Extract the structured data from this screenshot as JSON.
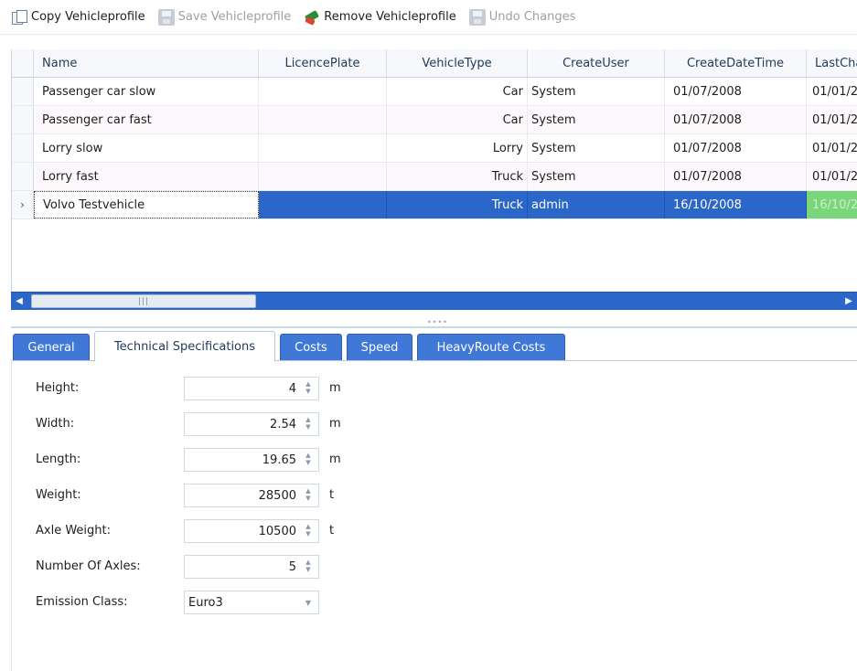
{
  "toolbar": {
    "copy_label": "Copy Vehicleprofile",
    "save_label": "Save Vehicleprofile",
    "remove_label": "Remove Vehicleprofile",
    "undo_label": "Undo Changes"
  },
  "grid": {
    "columns": [
      "Name",
      "LicencePlate",
      "VehicleType",
      "CreateUser",
      "CreateDateTime",
      "LastCha"
    ],
    "rows": [
      {
        "name": "Passenger car slow",
        "licence": "",
        "type": "Car",
        "user": "System",
        "created": "01/07/2008",
        "last": "01/01/2"
      },
      {
        "name": "Passenger car fast",
        "licence": "",
        "type": "Car",
        "user": "System",
        "created": "01/07/2008",
        "last": "01/01/2"
      },
      {
        "name": "Lorry slow",
        "licence": "",
        "type": "Lorry",
        "user": "System",
        "created": "01/07/2008",
        "last": "01/01/2"
      },
      {
        "name": "Lorry fast",
        "licence": "",
        "type": "Truck",
        "user": "System",
        "created": "01/07/2008",
        "last": "01/01/2"
      },
      {
        "name": "Volvo Testvehicle",
        "licence": "",
        "type": "Truck",
        "user": "admin",
        "created": "16/10/2008",
        "last": "16/10/2"
      }
    ],
    "selected_row_marker": "›",
    "scroll_left_arrow": "◀",
    "scroll_right_arrow": "▶",
    "scroll_grip": "|||"
  },
  "tabs": [
    "General",
    "Technical Specifications",
    "Costs",
    "Speed",
    "HeavyRoute Costs"
  ],
  "active_tab": "Technical Specifications",
  "specs": {
    "height": {
      "label": "Height:",
      "value": "4",
      "unit": "m"
    },
    "width": {
      "label": "Width:",
      "value": "2.54",
      "unit": "m"
    },
    "length": {
      "label": "Length:",
      "value": "19.65",
      "unit": "m"
    },
    "weight": {
      "label": "Weight:",
      "value": "28500",
      "unit": "t"
    },
    "axle_weight": {
      "label": "Axle Weight:",
      "value": "10500",
      "unit": "t"
    },
    "axles": {
      "label": "Number Of Axles:",
      "value": "5"
    },
    "emission": {
      "label": "Emission Class:",
      "value": "Euro3"
    }
  },
  "colors": {
    "selection": "#2b67c9",
    "tab_blue": "#3f78d6",
    "highlight_green": "#7bd67b"
  }
}
